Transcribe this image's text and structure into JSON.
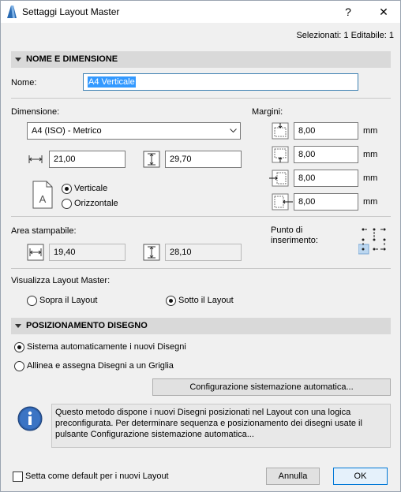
{
  "window": {
    "title": "Settaggi Layout Master",
    "help": "?",
    "close": "✕"
  },
  "selection_info": "Selezionati: 1 Editabile: 1",
  "section_name": {
    "label": "NOME E DIMENSIONE"
  },
  "name": {
    "label": "Nome:",
    "value": "A4 Verticale"
  },
  "dimension": {
    "label": "Dimensione:",
    "preset": "A4 (ISO) - Metrico",
    "width": "21,00",
    "height": "29,70",
    "orientation_options": [
      "Verticale",
      "Orizzontale"
    ],
    "orientation_selected": "Verticale",
    "page_letter": "A"
  },
  "margins": {
    "label": "Margini:",
    "top": "8,00",
    "bottom": "8,00",
    "left": "8,00",
    "right": "8,00",
    "unit": "mm"
  },
  "printable_area": {
    "label": "Area stampabile:",
    "width": "19,40",
    "height": "28,10"
  },
  "insertion_point": {
    "label": "Punto di\ninserimento:"
  },
  "show_master": {
    "label": "Visualizza Layout Master:",
    "options": [
      "Sopra il Layout",
      "Sotto il Layout"
    ],
    "selected": "Sotto il Layout"
  },
  "section_placement": {
    "label": "POSIZIONAMENTO DISEGNO"
  },
  "placement": {
    "options": [
      "Sistema automaticamente i nuovi Disegni",
      "Allinea e assegna Disegni a un Griglia"
    ],
    "selected": "Sistema automaticamente i nuovi Disegni",
    "config_button": "Configurazione sistemazione automatica...",
    "info_text": "Questo metodo dispone i nuovi Disegni posizionati nel Layout con una logica preconfigurata. Per determinare sequenza e posizionamento dei disegni usate il pulsante Configurazione sistemazione automatica..."
  },
  "footer": {
    "default_checkbox": "Setta come default per i nuovi Layout",
    "cancel": "Annulla",
    "ok": "OK"
  }
}
